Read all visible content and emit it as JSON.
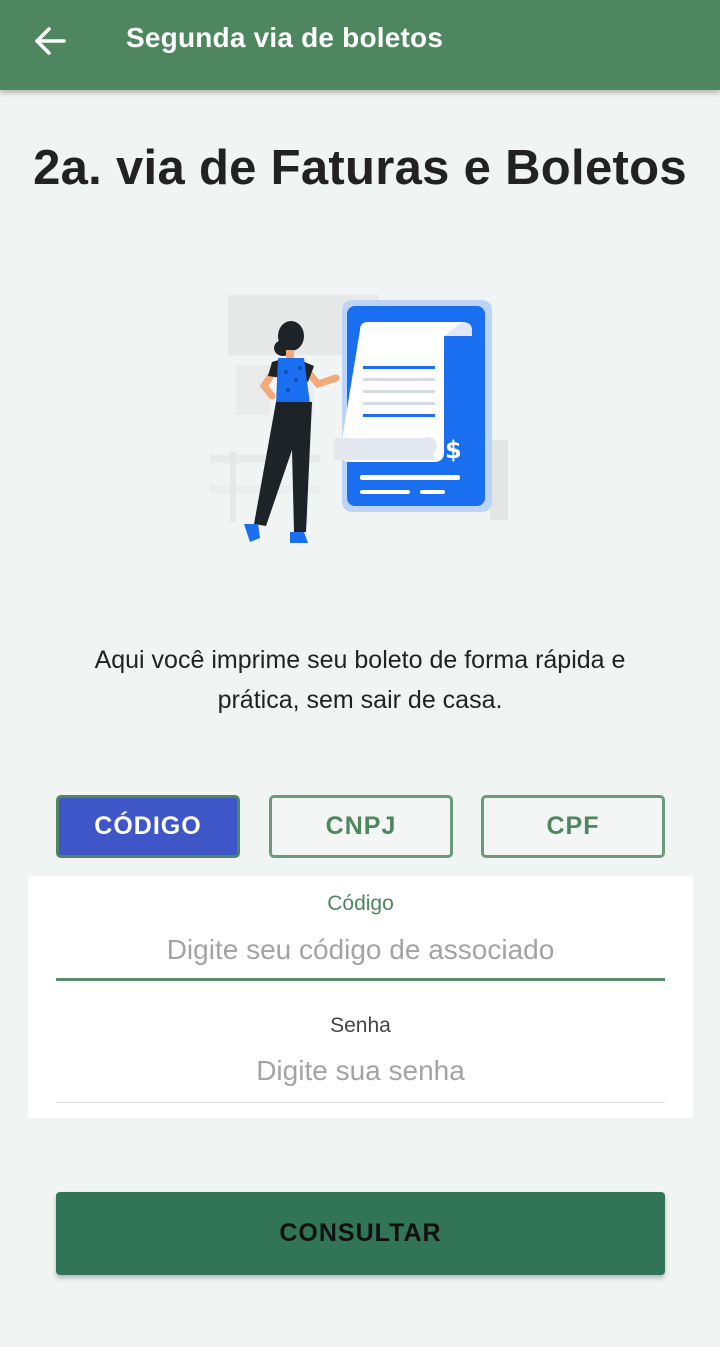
{
  "appbar": {
    "back_icon": "arrow-left-icon",
    "title": "Segunda via de boletos",
    "color": "#4e8660"
  },
  "page": {
    "title": "2a. via de Faturas e Boletos",
    "description": "Aqui você imprime seu boleto de forma rápida e prática, sem sair de casa."
  },
  "illustration": {
    "icon": "person-with-invoice-illustration",
    "currency_symbol": "$",
    "accent": "#1a6ef0"
  },
  "tabs": [
    {
      "label": "CÓDIGO",
      "active": true
    },
    {
      "label": "CNPJ",
      "active": false
    },
    {
      "label": "CPF",
      "active": false
    }
  ],
  "form": {
    "codigo": {
      "label": "Código",
      "placeholder": "Digite seu código de associado",
      "value": ""
    },
    "senha": {
      "label": "Senha",
      "placeholder": "Digite sua senha",
      "value": ""
    }
  },
  "submit": {
    "label": "CONSULTAR"
  },
  "colors": {
    "primary": "#4e8660",
    "active_tab": "#3f56c8",
    "button": "#317458",
    "background": "#f0f4f3"
  }
}
